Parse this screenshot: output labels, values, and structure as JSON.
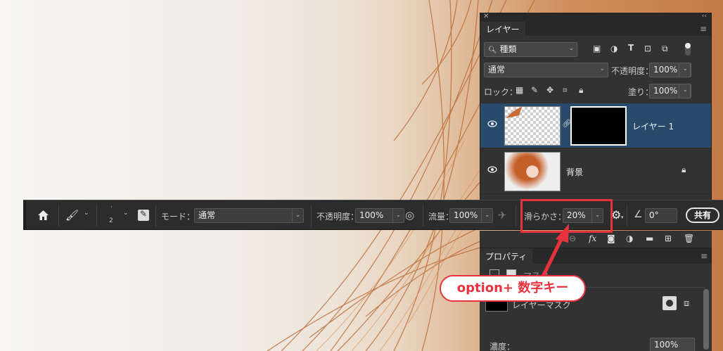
{
  "layers_panel": {
    "tab_title": "レイヤー",
    "filter_kind": "種類",
    "blend_mode": "通常",
    "opacity_label": "不透明度：",
    "opacity_value": "100%",
    "lock_label": "ロック：",
    "fill_label": "塗り：",
    "fill_value": "100%",
    "layers": [
      {
        "name": "レイヤー 1",
        "selected": true
      },
      {
        "name": "背景",
        "selected": false
      }
    ]
  },
  "options_bar": {
    "brush_size": "2",
    "mode_label": "モード：",
    "mode_value": "通常",
    "opacity_label": "不透明度：",
    "opacity_value": "100%",
    "flow_label": "流量：",
    "flow_value": "100%",
    "smoothing_label": "滑らかさ：",
    "smoothing_value": "20%",
    "angle_value": "0°",
    "share_label": "共有"
  },
  "annotation": {
    "callout_text": "option+ 数字キー",
    "color": "#e8333f"
  },
  "properties_panel": {
    "tab_title": "プロパティ",
    "mask_section_label": "マスク",
    "layer_mask_label": "レイヤーマスク",
    "density_label": "濃度：",
    "density_value": "100%"
  }
}
